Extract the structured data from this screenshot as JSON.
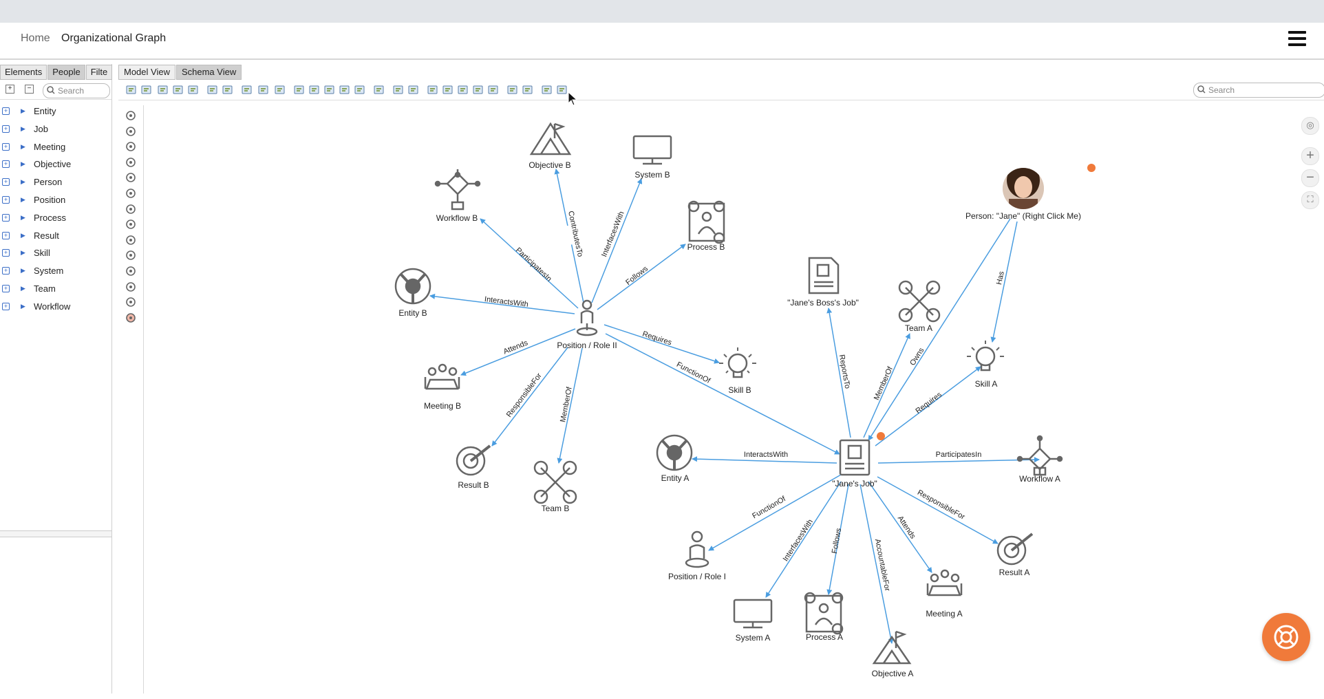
{
  "breadcrumb": {
    "home": "Home",
    "current": "Organizational Graph"
  },
  "left_panel": {
    "tabs": [
      "Elements",
      "People",
      "Filte"
    ],
    "search_placeholder": "Search",
    "tree_items": [
      "Entity",
      "Job",
      "Meeting",
      "Objective",
      "Person",
      "Position",
      "Process",
      "Result",
      "Skill",
      "System",
      "Team",
      "Workflow"
    ]
  },
  "main": {
    "view_tabs": [
      "Model View",
      "Schema View"
    ],
    "search_placeholder": "Search"
  },
  "graph": {
    "nodes": {
      "objective_b": "Objective B",
      "system_b": "System B",
      "workflow_b": "Workflow B",
      "process_b": "Process B",
      "entity_b": "Entity B",
      "position_role_ii": "Position / Role II",
      "skill_b": "Skill B",
      "meeting_b": "Meeting B",
      "result_b": "Result B",
      "team_b": "Team B",
      "janes_boss_job": "\"Jane's Boss's Job\"",
      "team_a": "Team A",
      "skill_a": "Skill A",
      "person_jane": "Person: \"Jane\" (Right Click Me)",
      "entity_a": "Entity A",
      "janes_job": "\"Jane's Job\"",
      "workflow_a": "Workflow A",
      "position_role_i": "Position / Role I",
      "result_a": "Result A",
      "meeting_a": "Meeting A",
      "system_a": "System A",
      "process_a": "Process A",
      "objective_a": "Objective A"
    },
    "edges": {
      "contributes_to": "ContributesTo",
      "interfaces_with_b": "InterfacesWith",
      "participates_in_b": "ParticipatesIn",
      "follows_b": "Follows",
      "interacts_with_b": "InteractsWith",
      "requires_b": "Requires",
      "attends_b": "Attends",
      "function_of_ii": "FunctionOf",
      "responsible_for_b": "ResponsibleFor",
      "member_of_b": "MemberOf",
      "reports_to": "ReportsTo",
      "member_of_a": "MemberOf",
      "owns": "Owns",
      "has": "Has",
      "requires_a": "Requires",
      "interacts_with_a": "InteractsWith",
      "participates_in_a": "ParticipatesIn",
      "function_of_i": "FunctionOf",
      "interfaces_with_a": "InterfacesWith",
      "follows_a": "Follows",
      "accountable_for": "AccountableFor",
      "attends_a": "Attends",
      "responsible_for_a": "ResponsibleFor"
    }
  },
  "colors": {
    "edge": "#4a9de0",
    "accent": "#f07a3a",
    "icon": "#666666"
  }
}
